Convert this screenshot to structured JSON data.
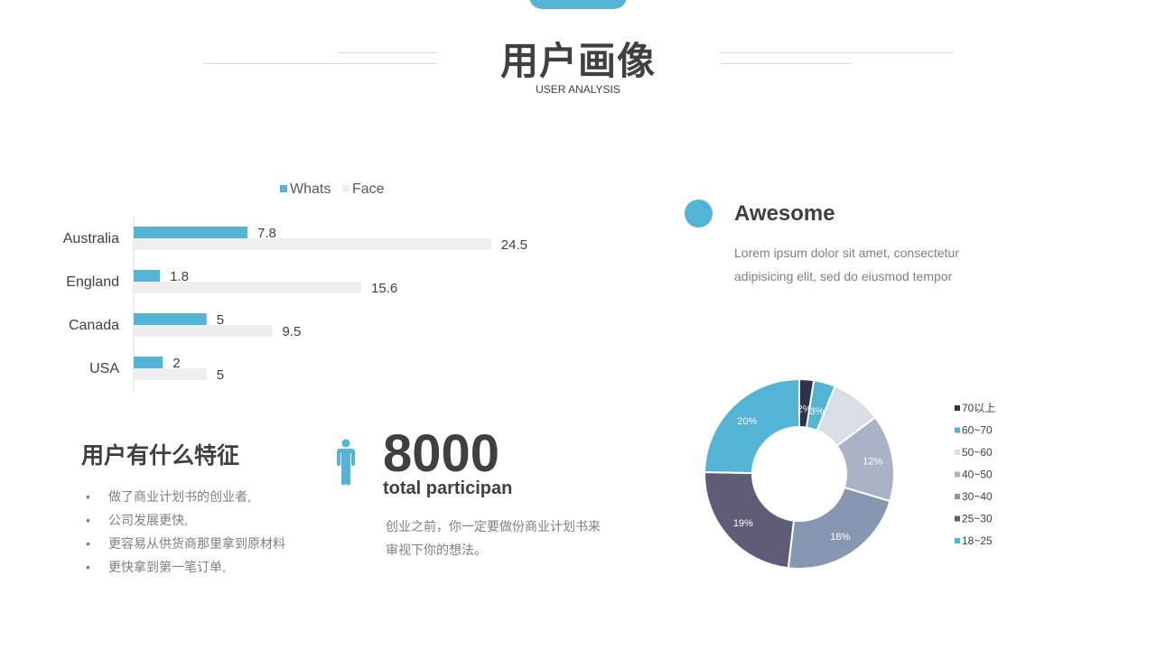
{
  "header": {
    "title": "用户画像",
    "subtitle": "USER ANALYSIS"
  },
  "colors": {
    "accent": "#53b4d6",
    "light_bar": "#eeeeee",
    "text_dark": "#404040",
    "text_gray": "#7f7f7f"
  },
  "awesome": {
    "title": "Awesome",
    "text": "Lorem ipsum dolor sit amet, consectetur adipisicing elit, sed do eiusmod tempor"
  },
  "features": {
    "title": "用户有什么特征",
    "bullet": "•",
    "items": [
      "做了商业计划书的创业者,",
      "公司发展更快,",
      "更容易从供货商那里拿到原材料",
      "更快拿到第一笔订单,"
    ]
  },
  "stat": {
    "icon": "person-icon",
    "number": "8000",
    "label": "total participan",
    "description": "创业之前，你一定要做份商业计划书来审视下你的想法。"
  },
  "chart_data": [
    {
      "type": "bar",
      "orientation": "horizontal",
      "categories": [
        "Australia",
        "England",
        "Canada",
        "USA"
      ],
      "series": [
        {
          "name": "Whats",
          "values": [
            7.8,
            1.8,
            5,
            2
          ],
          "color": "#53b4d6"
        },
        {
          "name": "Face",
          "values": [
            24.5,
            15.6,
            9.5,
            5
          ],
          "color": "#eeeeee"
        }
      ],
      "xlim": [
        0,
        26
      ],
      "legend": "top",
      "grid": false
    },
    {
      "type": "pie",
      "donut": true,
      "slices": [
        {
          "label": "70以上",
          "value": 2,
          "text": "2%",
          "color": "#2e3350"
        },
        {
          "label": "60~70",
          "value": 3,
          "text": "3%",
          "color": "#53b4d6"
        },
        {
          "label": "50~60",
          "value": 7,
          "text": "",
          "color": "#d8dde6"
        },
        {
          "label": "40~50",
          "value": 12,
          "text": "12%",
          "color": "#aab3c6"
        },
        {
          "label": "30~40",
          "value": 18,
          "text": "18%",
          "color": "#8797b2"
        },
        {
          "label": "25~30",
          "value": 19,
          "text": "19%",
          "color": "#5e5c77"
        },
        {
          "label": "18~25",
          "value": 20,
          "text": "20%",
          "color": "#53b4d6"
        }
      ],
      "legend": "right"
    }
  ]
}
